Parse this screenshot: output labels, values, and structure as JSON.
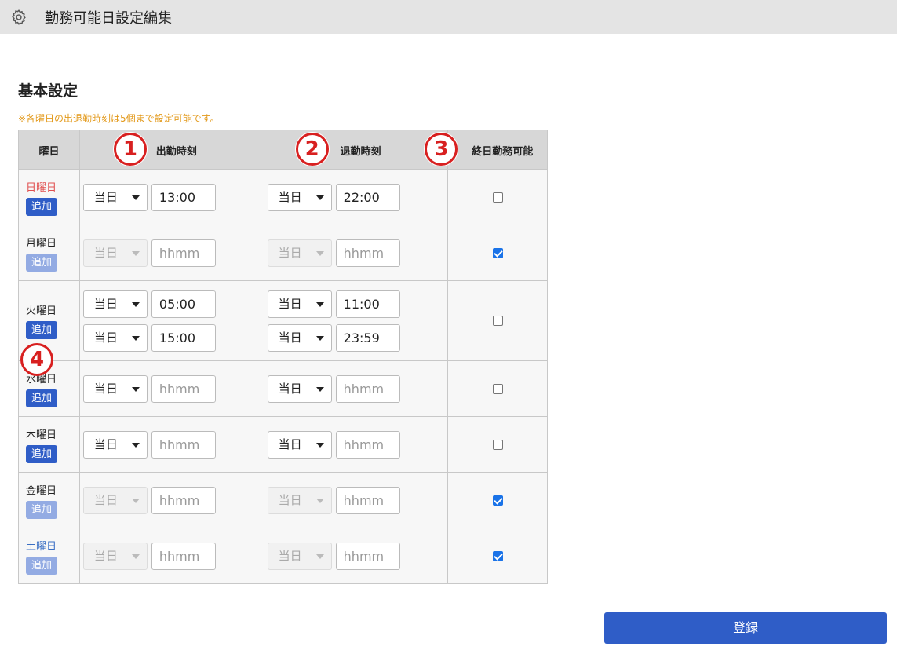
{
  "header": {
    "title": "勤務可能日設定編集",
    "icon": "gear-icon"
  },
  "section": {
    "title": "基本設定",
    "note": "※各曜日の出退勤時刻は5個まで設定可能です。"
  },
  "table": {
    "headers": {
      "day": "曜日",
      "start": "出勤時刻",
      "end": "退勤時刻",
      "allday": "終日勤務可能"
    },
    "markers": {
      "m1": "1",
      "m2": "2",
      "m3": "3",
      "m4": "4"
    },
    "rows": [
      {
        "day": "日曜日",
        "add": "追加",
        "add_enabled": true,
        "allday": false,
        "slots": [
          {
            "start_day": "当日",
            "start": "13:00",
            "end_day": "当日",
            "end": "22:00"
          }
        ]
      },
      {
        "day": "月曜日",
        "add": "追加",
        "add_enabled": false,
        "allday": true,
        "slots": [
          {
            "start_day": "当日",
            "start": "hhmm",
            "end_day": "当日",
            "end": "hhmm"
          }
        ]
      },
      {
        "day": "火曜日",
        "add": "追加",
        "add_enabled": true,
        "allday": false,
        "slots": [
          {
            "start_day": "当日",
            "start": "05:00",
            "end_day": "当日",
            "end": "11:00"
          },
          {
            "start_day": "当日",
            "start": "15:00",
            "end_day": "当日",
            "end": "23:59"
          }
        ]
      },
      {
        "day": "水曜日",
        "add": "追加",
        "add_enabled": true,
        "allday": false,
        "slots": [
          {
            "start_day": "当日",
            "start": "hhmm",
            "end_day": "当日",
            "end": "hhmm"
          }
        ]
      },
      {
        "day": "木曜日",
        "add": "追加",
        "add_enabled": true,
        "allday": false,
        "slots": [
          {
            "start_day": "当日",
            "start": "hhmm",
            "end_day": "当日",
            "end": "hhmm"
          }
        ]
      },
      {
        "day": "金曜日",
        "add": "追加",
        "add_enabled": false,
        "allday": true,
        "slots": [
          {
            "start_day": "当日",
            "start": "hhmm",
            "end_day": "当日",
            "end": "hhmm"
          }
        ]
      },
      {
        "day": "土曜日",
        "add": "追加",
        "add_enabled": false,
        "allday": true,
        "slots": [
          {
            "start_day": "当日",
            "start": "hhmm",
            "end_day": "当日",
            "end": "hhmm"
          }
        ]
      }
    ]
  },
  "submit_label": "登録",
  "colors": {
    "accent": "#2f5dc7",
    "accent_disabled": "#93abe3",
    "note": "#e39a1c",
    "sunday": "#e05050",
    "saturday": "#3a6fc4",
    "marker": "#d82020"
  }
}
